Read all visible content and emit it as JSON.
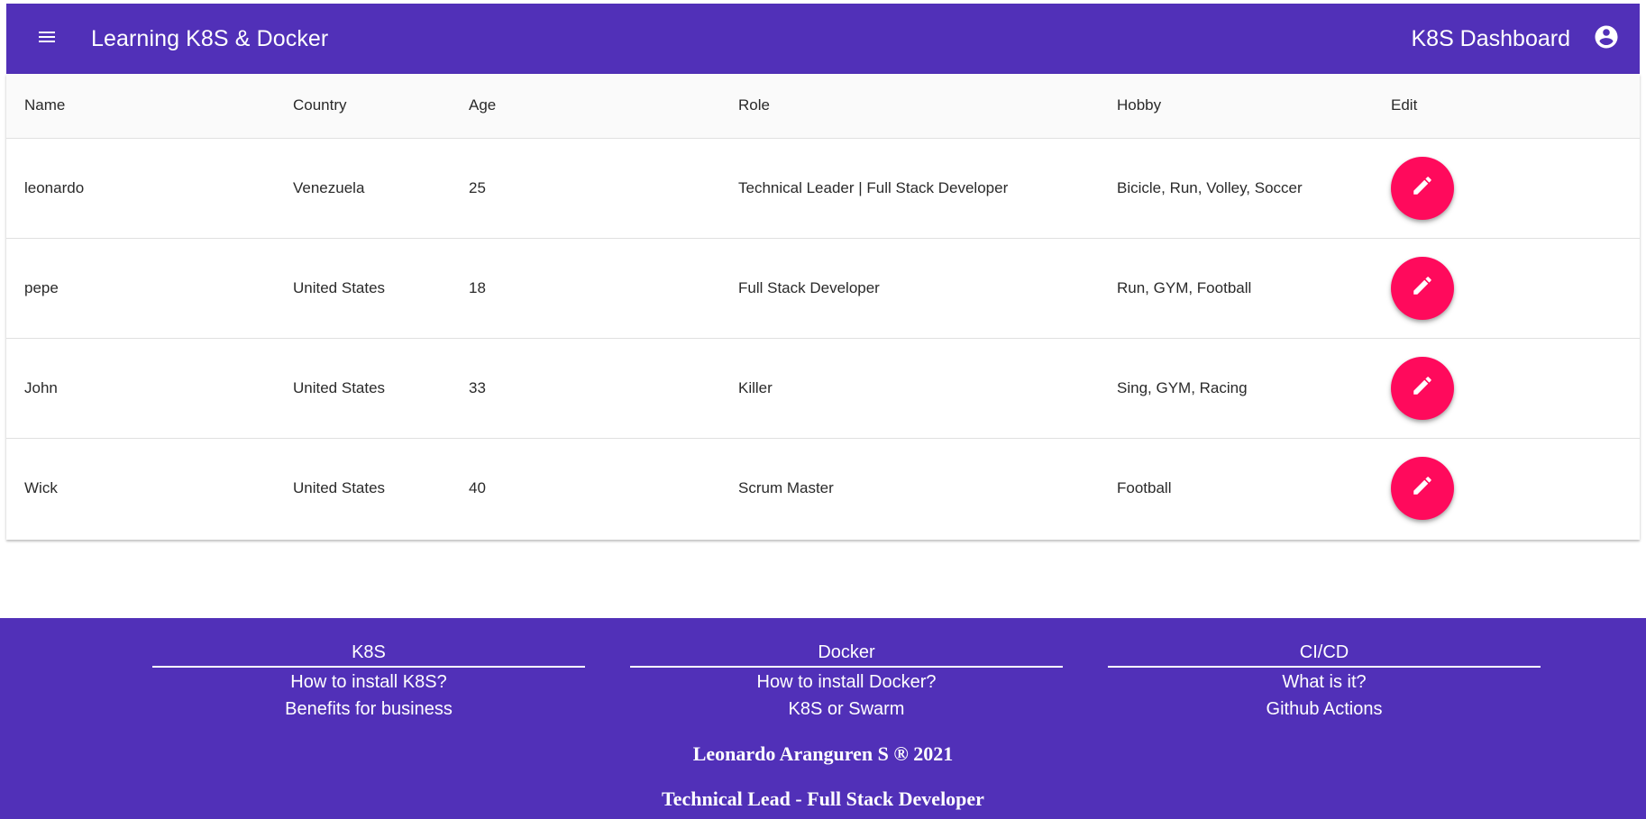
{
  "header": {
    "title": "Learning K8S & Docker",
    "dashboard_link": "K8S Dashboard",
    "menu_icon": "hamburger-menu-icon",
    "account_icon": "account-circle-icon",
    "background_color": "#5130b8"
  },
  "table": {
    "columns": [
      "Name",
      "Country",
      "Age",
      "Role",
      "Hobby",
      "Edit"
    ],
    "rows": [
      {
        "name": "leonardo",
        "country": "Venezuela",
        "age": "25",
        "role": "Technical Leader | Full Stack Developer",
        "hobby": "Bicicle, Run, Volley, Soccer"
      },
      {
        "name": "pepe",
        "country": "United States",
        "age": "18",
        "role": "Full Stack Developer",
        "hobby": "Run, GYM, Football"
      },
      {
        "name": "John",
        "country": "United States",
        "age": "33",
        "role": "Killer",
        "hobby": "Sing, GYM, Racing"
      },
      {
        "name": "Wick",
        "country": "United States",
        "age": "40",
        "role": "Scrum Master",
        "hobby": "Football"
      }
    ],
    "edit_icon": "pencil-icon",
    "edit_button_color": "#ff0a5c"
  },
  "footer": {
    "columns": [
      {
        "title": "K8S",
        "links": [
          "How to install K8S?",
          "Benefits for business"
        ]
      },
      {
        "title": "Docker",
        "links": [
          "How to install Docker?",
          "K8S or Swarm"
        ]
      },
      {
        "title": "CI/CD",
        "links": [
          "What is it?",
          "Github Actions"
        ]
      }
    ],
    "author": "Leonardo Aranguren S ® 2021",
    "role": "Technical Lead - Full Stack Developer",
    "background_color": "#5130b8"
  }
}
